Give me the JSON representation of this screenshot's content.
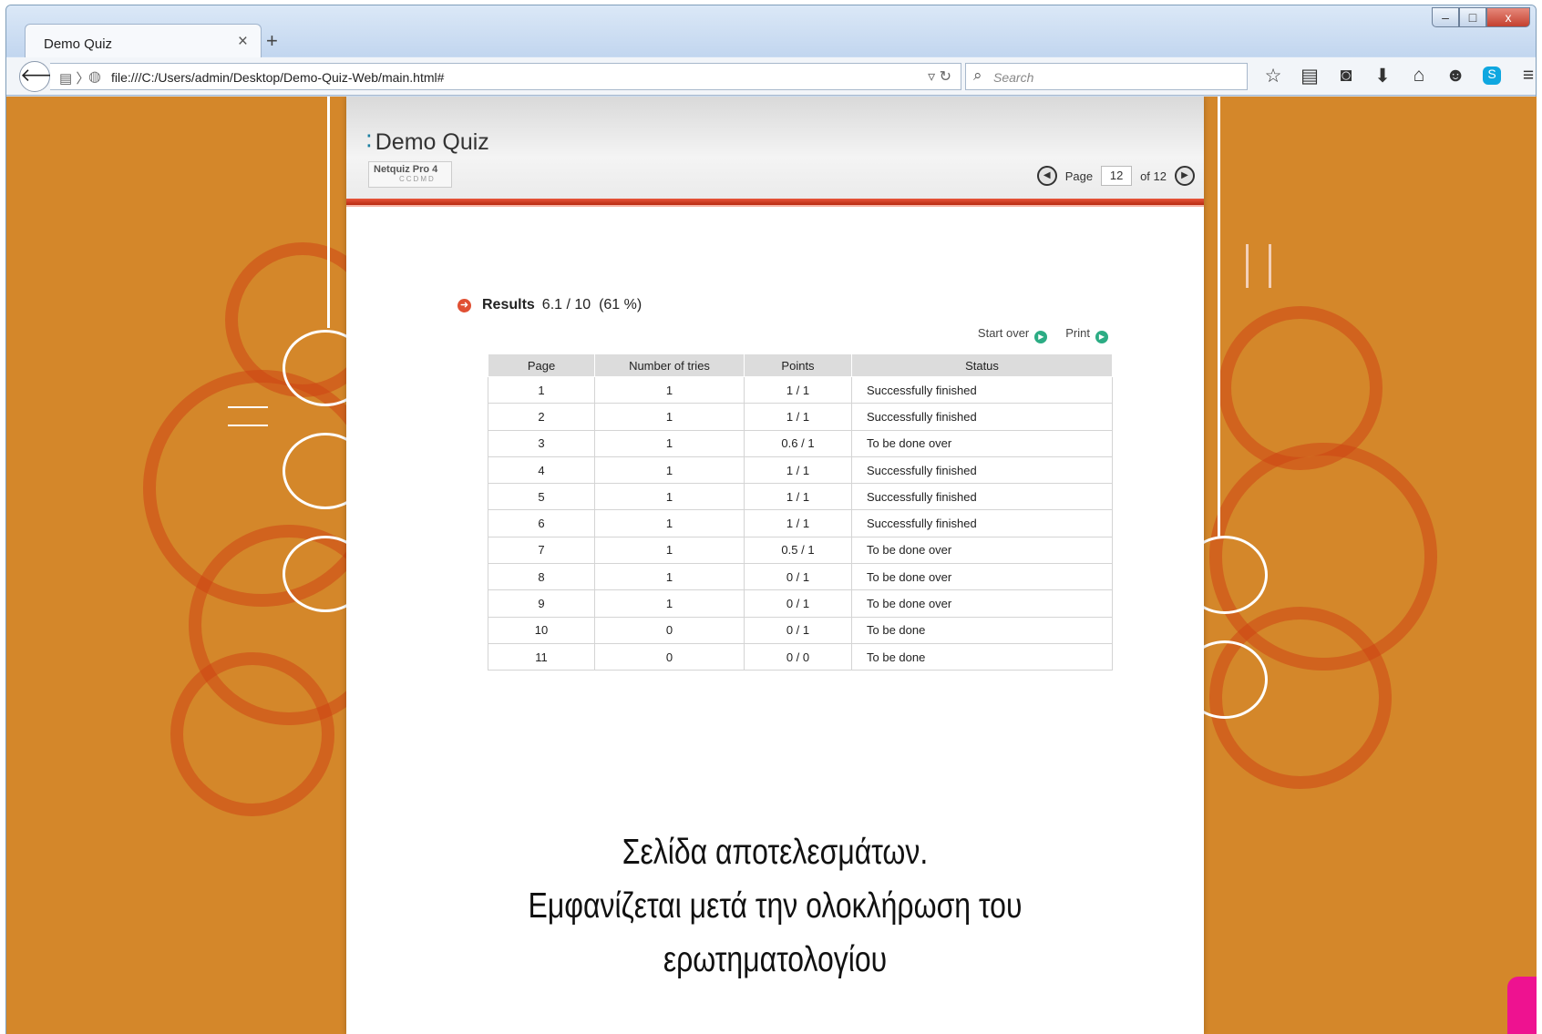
{
  "browser": {
    "tab_title": "Demo Quiz",
    "tab_close": "×",
    "new_tab": "+",
    "url": "file:///C:/Users/admin/Desktop/Demo-Quiz-Web/main.html#",
    "search_placeholder": "Search",
    "window_buttons": {
      "minimize": "–",
      "maximize": "□",
      "close": "x"
    }
  },
  "quiz": {
    "title": "Demo Quiz",
    "logo": "Netquiz Pro 4",
    "logo_sub": "CCDMD",
    "pager": {
      "label": "Page",
      "current": "12",
      "of_label": "of 12"
    },
    "results": {
      "label": "Results",
      "score": "6.1 / 10  (61 %)"
    },
    "actions": {
      "start_over": "Start over",
      "print": "Print"
    },
    "table": {
      "headers": [
        "Page",
        "Number of tries",
        "Points",
        "Status"
      ],
      "rows": [
        [
          "1",
          "1",
          "1 / 1",
          "Successfully finished"
        ],
        [
          "2",
          "1",
          "1 / 1",
          "Successfully finished"
        ],
        [
          "3",
          "1",
          "0.6 / 1",
          "To be done over"
        ],
        [
          "4",
          "1",
          "1 / 1",
          "Successfully finished"
        ],
        [
          "5",
          "1",
          "1 / 1",
          "Successfully finished"
        ],
        [
          "6",
          "1",
          "1 / 1",
          "Successfully finished"
        ],
        [
          "7",
          "1",
          "0.5 / 1",
          "To be done over"
        ],
        [
          "8",
          "1",
          "0 / 1",
          "To be done over"
        ],
        [
          "9",
          "1",
          "0 / 1",
          "To be done over"
        ],
        [
          "10",
          "0",
          "0 / 1",
          "To be done"
        ],
        [
          "11",
          "0",
          "0 / 0",
          "To be done"
        ]
      ]
    },
    "caption_line1": "Σελίδα αποτελεσμάτων.",
    "caption_line2": "Εμφανίζεται μετά την ολοκλήρωση του ερωτηματολογίου"
  },
  "colors": {
    "background": "#d4872a",
    "accent_red": "#e05033",
    "accent_green": "#2cac84"
  }
}
